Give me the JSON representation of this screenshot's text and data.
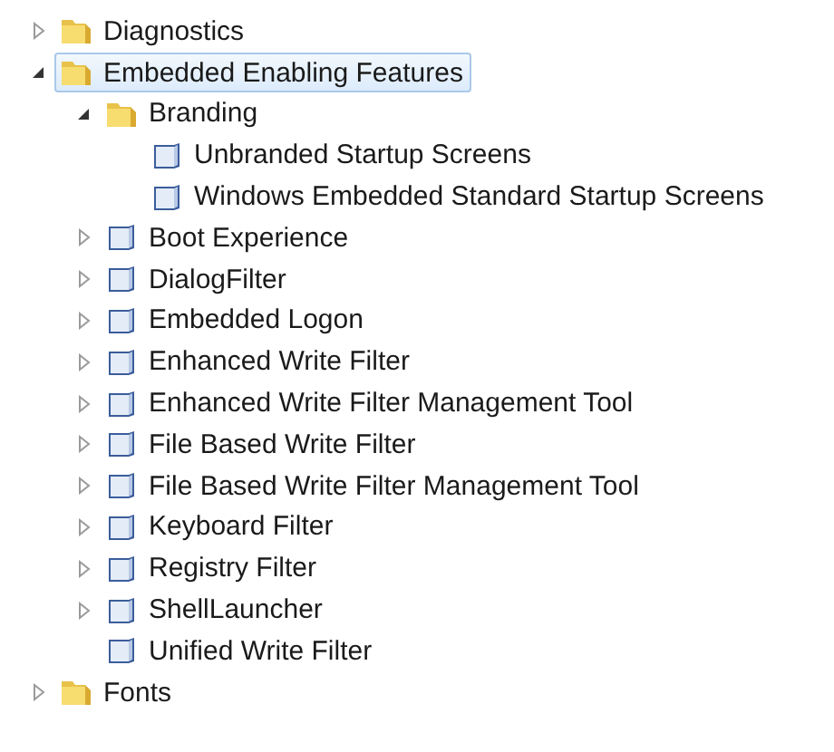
{
  "tree": [
    {
      "label": "Diagnostics",
      "kind": "folder",
      "expanded": false,
      "selected": false
    },
    {
      "label": "Embedded Enabling Features",
      "kind": "folder",
      "expanded": true,
      "selected": true,
      "children": [
        {
          "label": "Branding",
          "kind": "folder",
          "expanded": true,
          "selected": false,
          "children": [
            {
              "label": "Unbranded Startup Screens",
              "kind": "component",
              "selected": false
            },
            {
              "label": "Windows Embedded Standard Startup Screens",
              "kind": "component",
              "selected": false
            }
          ]
        },
        {
          "label": "Boot Experience",
          "kind": "component",
          "expanded": false,
          "selected": false
        },
        {
          "label": "DialogFilter",
          "kind": "component",
          "expanded": false,
          "selected": false
        },
        {
          "label": "Embedded Logon",
          "kind": "component",
          "expanded": false,
          "selected": false
        },
        {
          "label": "Enhanced Write Filter",
          "kind": "component",
          "expanded": false,
          "selected": false
        },
        {
          "label": "Enhanced Write Filter Management Tool",
          "kind": "component",
          "expanded": false,
          "selected": false
        },
        {
          "label": "File Based Write Filter",
          "kind": "component",
          "expanded": false,
          "selected": false
        },
        {
          "label": "File Based Write Filter Management Tool",
          "kind": "component",
          "expanded": false,
          "selected": false
        },
        {
          "label": "Keyboard Filter",
          "kind": "component",
          "expanded": false,
          "selected": false
        },
        {
          "label": "Registry Filter",
          "kind": "component",
          "expanded": false,
          "selected": false
        },
        {
          "label": "ShellLauncher",
          "kind": "component",
          "expanded": false,
          "selected": false
        },
        {
          "label": "Unified Write Filter",
          "kind": "component",
          "selected": false
        }
      ]
    },
    {
      "label": "Fonts",
      "kind": "folder",
      "expanded": false,
      "selected": false
    }
  ]
}
